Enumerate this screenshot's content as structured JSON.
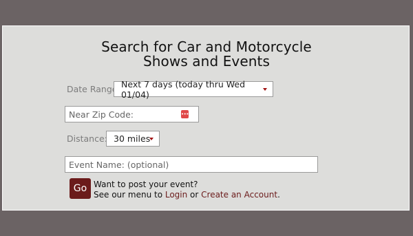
{
  "page": {
    "title_line1": "Search for Car and Motorcycle",
    "title_line2": "Shows and Events"
  },
  "form": {
    "date_range_label": "Date Range:",
    "date_range_value": "Next 7 days (today thru Wed 01/04)",
    "zip_placeholder": "Near Zip Code:",
    "distance_label": "Distance:",
    "distance_value": "30 miles",
    "event_name_placeholder": "Event Name: (optional)",
    "go_label": "Go"
  },
  "message": {
    "line1": "Want to post your event?",
    "line2_prefix": "See our menu to ",
    "login_link": "Login",
    "or_text": " or ",
    "create_account_link": "Create an Account",
    "end": "."
  },
  "icons": {
    "password_manager": "password-manager-icon",
    "dropdown": "chevron-down-icon"
  },
  "colors": {
    "accent": "#6b1b1b",
    "panel": "#dddddb",
    "background": "#6b6364"
  }
}
